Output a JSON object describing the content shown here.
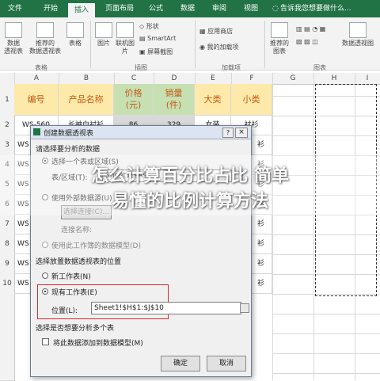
{
  "ribbon": {
    "tabs": [
      "文件",
      "开始",
      "插入",
      "页面布局",
      "公式",
      "数据",
      "审阅",
      "视图"
    ],
    "active_tab": "插入",
    "tell_me": "告诉我您想要做什么...",
    "buttons": {
      "pivot": "数据\n透视表",
      "recommended_pivot": "推荐的\n数据透视表",
      "table": "表格",
      "picture": "图片",
      "online_picture": "联机图片",
      "shapes": "形状",
      "smartart": "SmartArt",
      "screenshot": "屏幕截图",
      "app_store": "应用商店",
      "my_addins": "我的加载项",
      "recommended_charts": "推荐的\n图表",
      "pivot_chart": "数据透视图"
    },
    "groups": {
      "tables": "表格",
      "illustrations": "插图",
      "addins": "加载项",
      "charts": "图表"
    }
  },
  "sheet": {
    "columns": [
      "A",
      "B",
      "C",
      "D",
      "E",
      "F",
      "G",
      "H",
      "I"
    ],
    "rows": [
      "1",
      "2",
      "3",
      "4",
      "5",
      "6",
      "7",
      "8",
      "9",
      "10"
    ],
    "header": [
      "编号",
      "产品名称",
      "价格\n(元)",
      "销量\n(件)",
      "大类",
      "小类"
    ],
    "row2": [
      "WS-560",
      "长袖白衬衫",
      "86",
      "329",
      "女装",
      "衬衫"
    ],
    "col_a_partial": [
      "WS",
      "WS",
      "WS",
      "WS",
      "WS",
      "WS",
      "WS",
      "WS"
    ],
    "col_f_partial": [
      "衫",
      "衫",
      "衫",
      "衫",
      "衫",
      "衫",
      "衫",
      "衫"
    ]
  },
  "dialog": {
    "title": "创建数据透视表",
    "help": "?",
    "close": "×",
    "section_choose_data": "请选择要分析的数据",
    "opt_select_range": "选择一个表或区域(S)",
    "range_label": "表/区域(T):",
    "range_value": "Sheet1!$A$1:$",
    "opt_external": "使用外部数据源(U)",
    "choose_connection": "选择连接(C)...",
    "connection_name": "连接名称:",
    "opt_data_model": "使用此工作簿的数据模型(D)",
    "section_location": "选择放置数据透视表的位置",
    "opt_new_sheet": "新工作表(N)",
    "opt_existing_sheet": "现有工作表(E)",
    "location_label": "位置(L):",
    "location_value": "Sheet1!$H$1:$J$10",
    "section_multi": "选择是否想要分析多个表",
    "add_to_model": "将此数据添加到数据模型(M)",
    "ok": "确定",
    "cancel": "取消"
  },
  "overlay": {
    "line1": "怎么计算百分比占比 简单",
    "line2": "易懂的比例计算方法"
  },
  "colors": {
    "excel_green": "#217346",
    "header_yellow": "#fde9a9",
    "header_green": "#c6e0b4",
    "highlight_red": "#e0272f"
  }
}
